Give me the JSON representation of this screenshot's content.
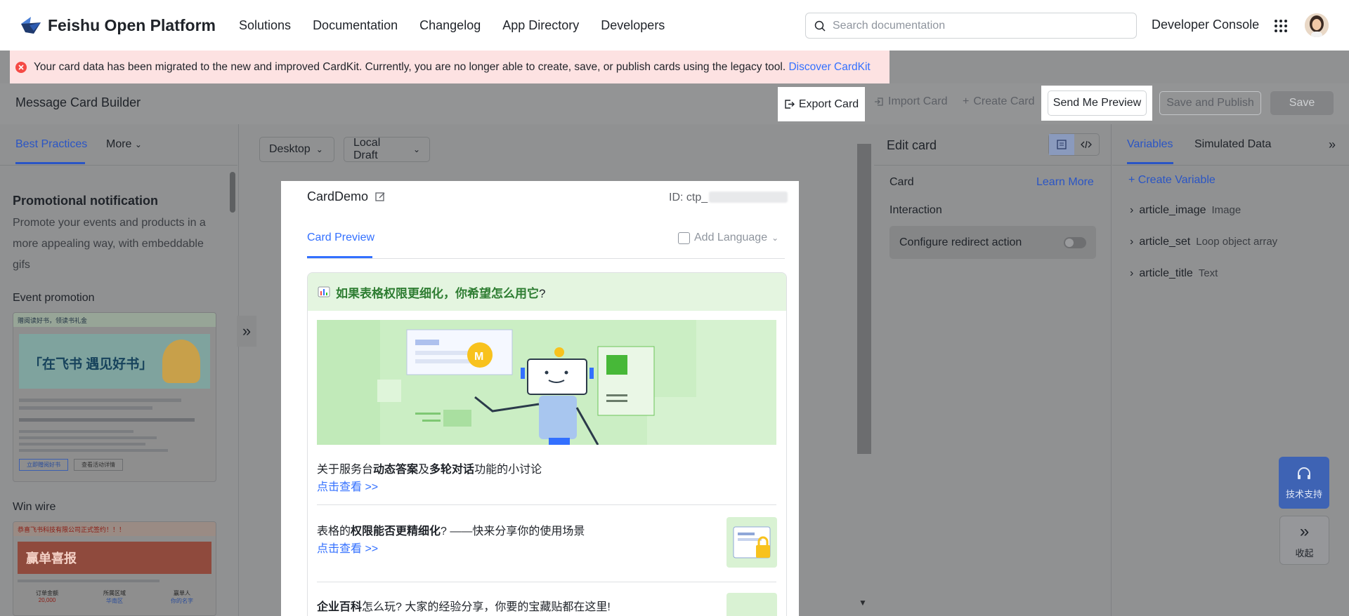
{
  "nav": {
    "logo_text": "Feishu Open Platform",
    "links": [
      "Solutions",
      "Documentation",
      "Changelog",
      "App Directory",
      "Developers"
    ],
    "search_placeholder": "Search documentation",
    "developer_console": "Developer Console"
  },
  "banner": {
    "message": "Your card data has been migrated to the new and improved CardKit. Currently, you are no longer able to create, save, or publish cards using the legacy tool.",
    "link": "Discover CardKit"
  },
  "toolbar": {
    "title": "Message Card Builder",
    "export": "Export Card",
    "import": "Import Card",
    "create": "Create Card",
    "send_preview": "Send Me Preview",
    "save_publish": "Save and Publish",
    "save": "Save"
  },
  "left": {
    "tab_active": "Best Practices",
    "tab_more": "More",
    "title": "Promotional notification",
    "desc": "Promote your events and products in a more appealing way, with embeddable gifs",
    "items": [
      "Event promotion",
      "Win wire"
    ],
    "thumb1": {
      "top": "赠阅读好书，领读书礼金",
      "headline": "「在飞书 遇见好书」",
      "btn1": "立即赠阅好书",
      "btn2": "查看活动详情"
    },
    "thumb2": {
      "top": "恭喜飞书科技有限公司正式签约！！！",
      "headline": "赢单喜报",
      "c1": "订单金额",
      "c2": "所属区域",
      "c3": "赢单人",
      "v1": "20,000",
      "v2": "华南区",
      "v3": "你的名字"
    }
  },
  "canvas": {
    "device": "Desktop",
    "draft": "Local Draft",
    "card_name": "CardDemo",
    "card_id_prefix": "ID: ctp_",
    "preview_tab": "Card Preview",
    "add_language": "Add Language"
  },
  "message": {
    "header": "如果表格权限更细化，你希望怎么用它",
    "header_q": "?",
    "item1_pre": "关于服务台",
    "item1_b1": "动态答案",
    "item1_mid": "及",
    "item1_b2": "多轮对话",
    "item1_post": "功能的小讨论",
    "link": "点击查看 >>",
    "item2_pre": "表格的",
    "item2_b": "权限能否更精细化",
    "item2_post": "? ——快来分享你的使用场景",
    "item3_b": "企业百科",
    "item3_post": "怎么玩? 大家的经验分享，你要的宝藏贴都在这里!"
  },
  "edit": {
    "title": "Edit card",
    "card_label": "Card",
    "learn_more": "Learn More",
    "interaction": "Interaction",
    "redirect": "Configure redirect action"
  },
  "vars": {
    "tab_active": "Variables",
    "tab2": "Simulated Data",
    "create": "Create Variable",
    "items": [
      {
        "name": "article_image",
        "type": "Image"
      },
      {
        "name": "article_set",
        "type": "Loop object array"
      },
      {
        "name": "article_title",
        "type": "Text"
      }
    ]
  },
  "float": {
    "support": "技术支持",
    "collapse": "收起"
  },
  "colors": {
    "accent": "#3370ff",
    "error": "#f54a45",
    "banner_bg": "#fde2e2",
    "card_header_bg": "#e4f5e0"
  }
}
